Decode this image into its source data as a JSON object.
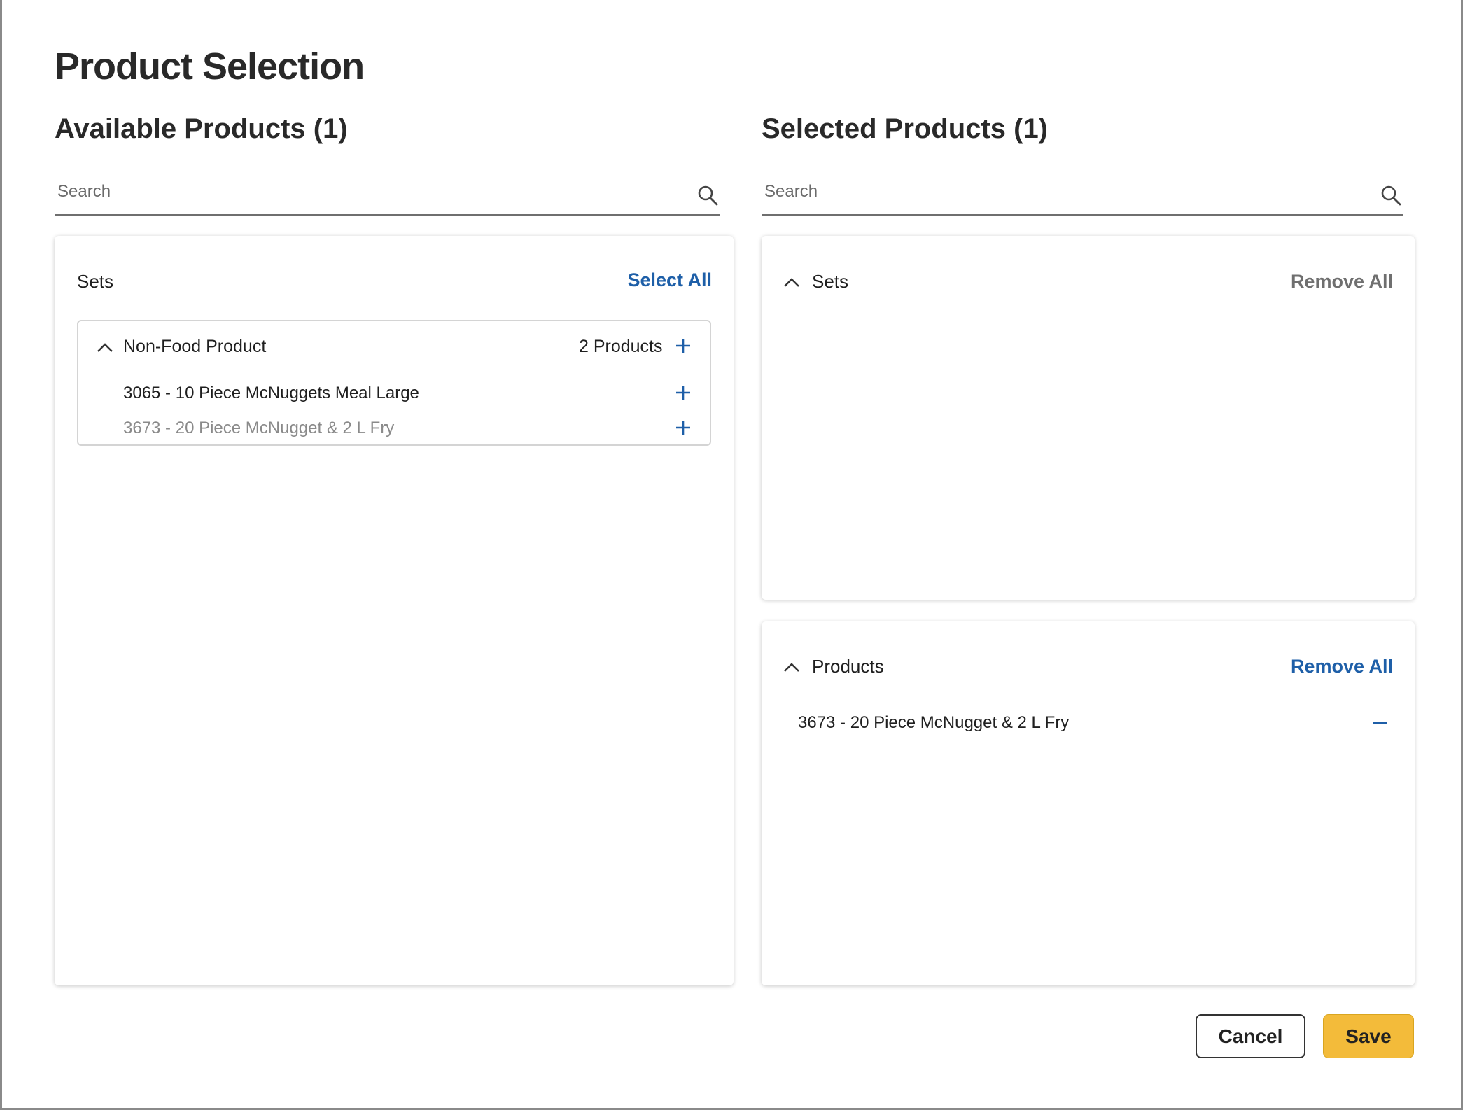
{
  "title": "Product Selection",
  "available": {
    "heading": "Available Products (1)",
    "search_placeholder": "Search",
    "sets_label": "Sets",
    "select_all_label": "Select All",
    "group": {
      "name": "Non-Food Product",
      "count_label": "2 Products",
      "items": [
        {
          "label": "3065 - 10 Piece McNuggets Meal Large",
          "muted": false
        },
        {
          "label": "3673 - 20 Piece McNugget & 2 L Fry",
          "muted": true
        }
      ]
    }
  },
  "selected": {
    "heading": "Selected Products (1)",
    "search_placeholder": "Search",
    "sets": {
      "label": "Sets",
      "remove_all_label": "Remove All"
    },
    "products": {
      "label": "Products",
      "remove_all_label": "Remove All",
      "items": [
        {
          "label": "3673 - 20 Piece McNugget & 2 L Fry"
        }
      ]
    }
  },
  "buttons": {
    "cancel": "Cancel",
    "save": "Save"
  },
  "colors": {
    "link": "#1e5fa8",
    "save": "#f3bb3a",
    "muted": "#8a8a8a"
  }
}
